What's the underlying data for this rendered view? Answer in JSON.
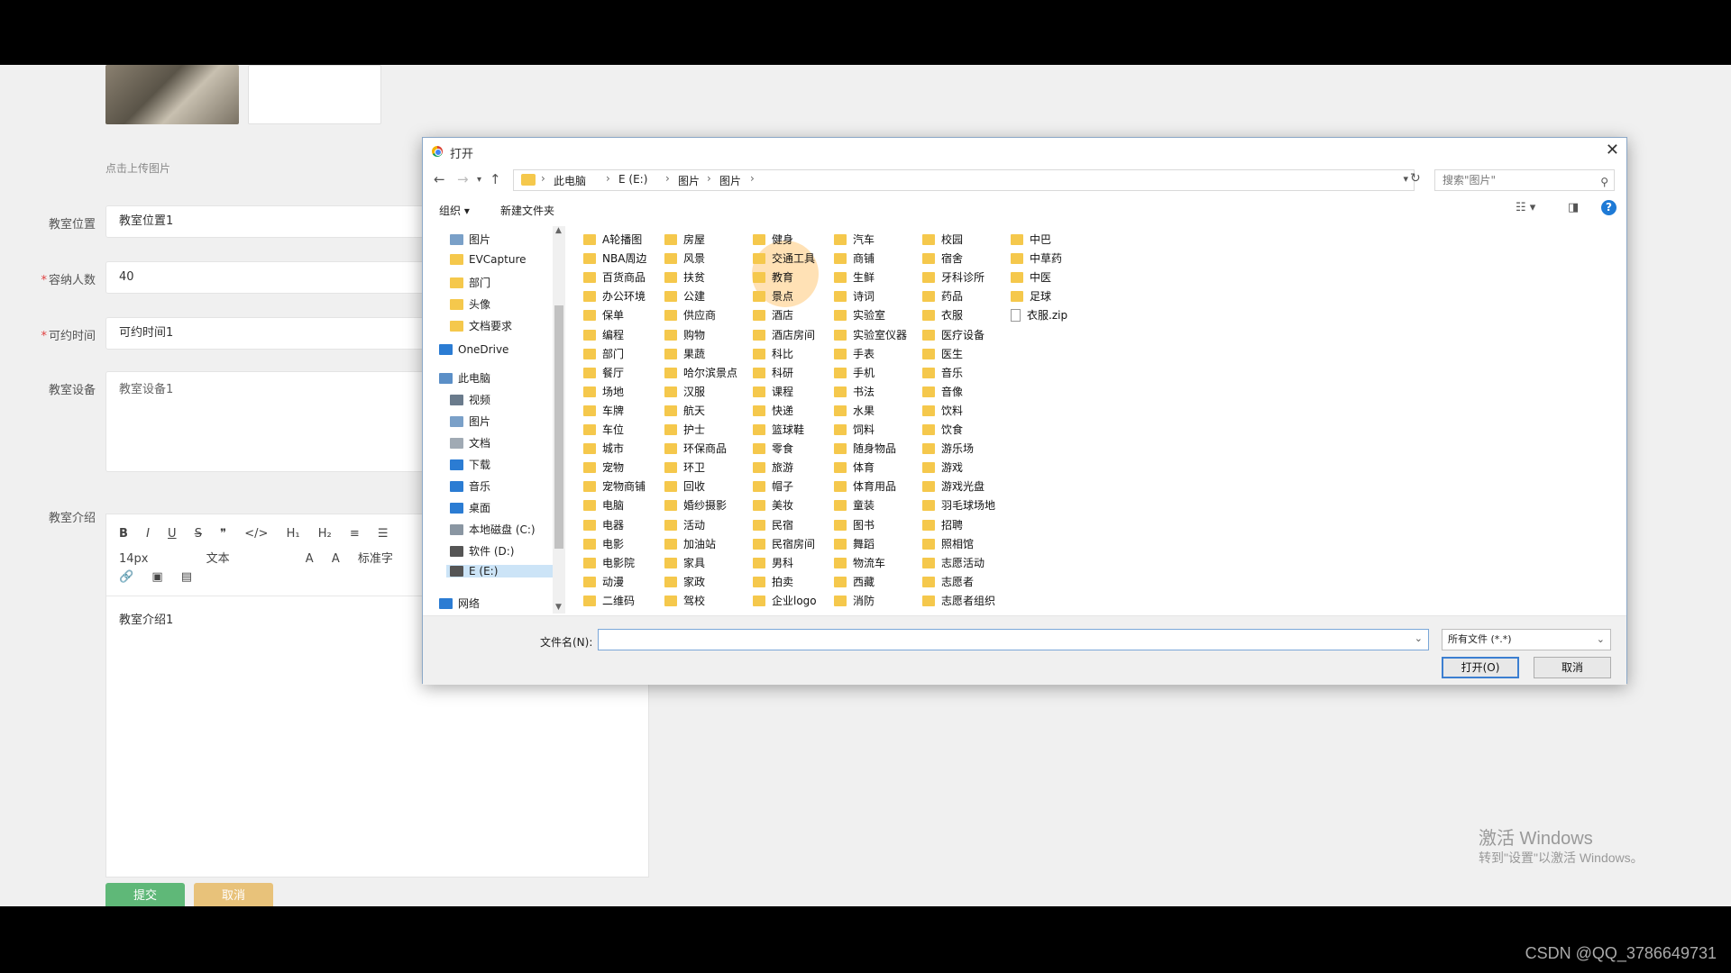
{
  "form": {
    "upload_hint": "点击上传图片",
    "location_label": "教室位置",
    "location_value": "教室位置1",
    "capacity_label": "容纳人数",
    "capacity_value": "40",
    "time_label": "可约时间",
    "time_value": "可约时间1",
    "equipment_label": "教室设备",
    "equipment_value": "教室设备1",
    "intro_label": "教室介绍",
    "intro_value": "教室介绍1",
    "required_mark": "*",
    "submit_label": "提交",
    "cancel_label": "取消"
  },
  "editor_toolbar": {
    "row1": [
      "B",
      "I",
      "U",
      "S",
      "❞",
      "</>",
      "H₁",
      "H₂",
      "≡",
      "☰"
    ],
    "font_size": "14px",
    "text_style": "文本",
    "normal": "标准字",
    "row3": [
      "🔗",
      "▣",
      "▤"
    ]
  },
  "dialog": {
    "title": "打开",
    "close": "✕",
    "breadcrumbs": [
      "此电脑",
      "E (E:)",
      "图片",
      "图片"
    ],
    "search_placeholder": "搜索\"图片\"",
    "organize": "组织 ▾",
    "new_folder": "新建文件夹",
    "help": "?",
    "nav_items": [
      {
        "label": "图片",
        "color": "#7aa0c8"
      },
      {
        "label": "EVCapture",
        "color": "#f5c84c"
      },
      {
        "label": "部门",
        "color": "#f5c84c"
      },
      {
        "label": "头像",
        "color": "#f5c84c"
      },
      {
        "label": "文档要求",
        "color": "#f5c84c"
      },
      {
        "label": "OneDrive",
        "color": "#2b7cd3"
      },
      {
        "label": "此电脑",
        "color": "#5b8fc7"
      },
      {
        "label": "视频",
        "color": "#6a7b8c"
      },
      {
        "label": "图片",
        "color": "#7aa0c8"
      },
      {
        "label": "文档",
        "color": "#a0aab4"
      },
      {
        "label": "下载",
        "color": "#2b7cd3"
      },
      {
        "label": "音乐",
        "color": "#2b7cd3"
      },
      {
        "label": "桌面",
        "color": "#2b7cd3"
      },
      {
        "label": "本地磁盘 (C:)",
        "color": "#8a96a2"
      },
      {
        "label": "软件 (D:)",
        "color": "#555"
      },
      {
        "label": "E (E:)",
        "color": "#555"
      },
      {
        "label": "网络",
        "color": "#2b7cd3"
      }
    ],
    "columns": [
      [
        "A轮播图",
        "NBA周边",
        "百货商品",
        "办公环境",
        "保单",
        "编程",
        "部门",
        "餐厅",
        "场地",
        "车牌",
        "车位",
        "城市",
        "宠物",
        "宠物商铺",
        "电脑",
        "电器",
        "电影",
        "电影院",
        "动漫",
        "二维码"
      ],
      [
        "房屋",
        "风景",
        "扶贫",
        "公建",
        "供应商",
        "购物",
        "果蔬",
        "哈尔滨景点",
        "汉服",
        "航天",
        "护士",
        "环保商品",
        "环卫",
        "回收",
        "婚纱摄影",
        "活动",
        "加油站",
        "家具",
        "家政",
        "驾校"
      ],
      [
        "健身",
        "交通工具",
        "教育",
        "景点",
        "酒店",
        "酒店房间",
        "科比",
        "科研",
        "课程",
        "快递",
        "篮球鞋",
        "零食",
        "旅游",
        "帽子",
        "美妆",
        "民宿",
        "民宿房间",
        "男科",
        "拍卖",
        "企业logo"
      ],
      [
        "汽车",
        "商铺",
        "生鲜",
        "诗词",
        "实验室",
        "实验室仪器",
        "手表",
        "手机",
        "书法",
        "水果",
        "饲料",
        "随身物品",
        "体育",
        "体育用品",
        "童装",
        "图书",
        "舞蹈",
        "物流车",
        "西藏",
        "消防"
      ],
      [
        "校园",
        "宿舍",
        "牙科诊所",
        "药品",
        "衣服",
        "医疗设备",
        "医生",
        "音乐",
        "音像",
        "饮料",
        "饮食",
        "游乐场",
        "游戏",
        "游戏光盘",
        "羽毛球场地",
        "招聘",
        "照相馆",
        "志愿活动",
        "志愿者",
        "志愿者组织"
      ],
      [
        "中巴",
        "中草药",
        "中医",
        "足球",
        "衣服.zip"
      ]
    ],
    "filename_label": "文件名(N):",
    "filetype": "所有文件 (*.*)",
    "open_button": "打开(O)",
    "cancel_button": "取消"
  },
  "windows_watermark": {
    "line1": "激活 Windows",
    "line2": "转到\"设置\"以激活 Windows。"
  },
  "csdn_watermark": "CSDN @QQ_3786649731"
}
